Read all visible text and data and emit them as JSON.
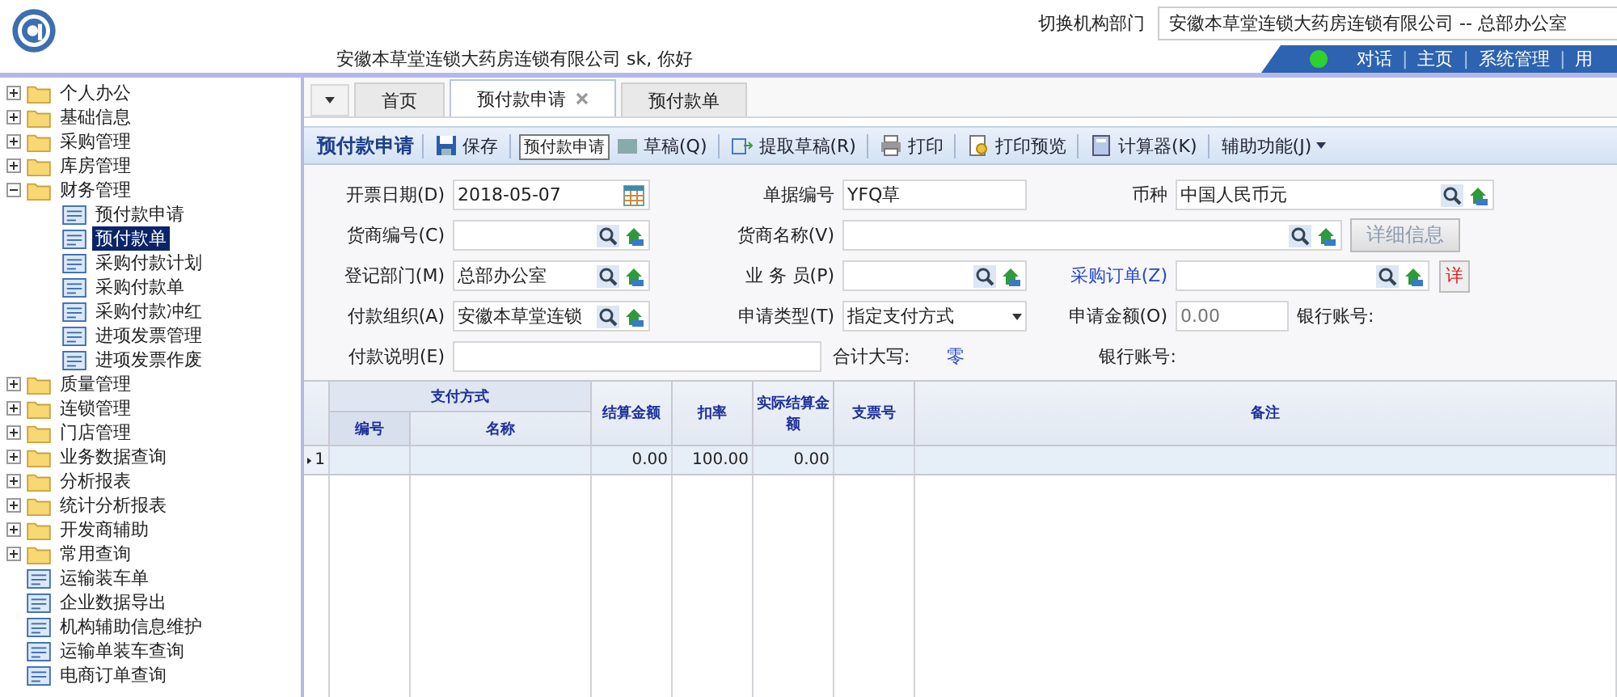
{
  "header": {
    "company_user": "安徽本草堂连锁大药房连锁有限公司  sk, 你好",
    "switch_label": "切换机构部门",
    "switch_value": "安徽本草堂连锁大药房连锁有限公司 -- 总部办公室",
    "nav": [
      {
        "kind": "link",
        "text": "对话"
      },
      {
        "kind": "sep",
        "text": "|"
      },
      {
        "kind": "link",
        "text": "主页"
      },
      {
        "kind": "sep",
        "text": "|"
      },
      {
        "kind": "link",
        "text": "系统管理"
      },
      {
        "kind": "sep",
        "text": "|"
      },
      {
        "kind": "link",
        "text": "用"
      }
    ]
  },
  "sidebar": {
    "items": [
      {
        "kind": "folder",
        "label": "个人办公",
        "expanded": false,
        "selected": false
      },
      {
        "kind": "folder",
        "label": "基础信息",
        "expanded": false,
        "selected": false
      },
      {
        "kind": "folder",
        "label": "采购管理",
        "expanded": false,
        "selected": false
      },
      {
        "kind": "folder",
        "label": "库房管理",
        "expanded": false,
        "selected": false
      },
      {
        "kind": "folder",
        "label": "财务管理",
        "expanded": true,
        "selected": false,
        "children": [
          {
            "kind": "leaf",
            "label": "预付款申请",
            "selected": false
          },
          {
            "kind": "leaf",
            "label": "预付款单",
            "selected": true
          },
          {
            "kind": "leaf",
            "label": "采购付款计划",
            "selected": false
          },
          {
            "kind": "leaf",
            "label": "采购付款单",
            "selected": false
          },
          {
            "kind": "leaf",
            "label": "采购付款冲红",
            "selected": false
          },
          {
            "kind": "leaf",
            "label": "进项发票管理",
            "selected": false
          },
          {
            "kind": "leaf",
            "label": "进项发票作废",
            "selected": false
          }
        ]
      },
      {
        "kind": "folder",
        "label": "质量管理",
        "expanded": false,
        "selected": false
      },
      {
        "kind": "folder",
        "label": "连锁管理",
        "expanded": false,
        "selected": false
      },
      {
        "kind": "folder",
        "label": "门店管理",
        "expanded": false,
        "selected": false
      },
      {
        "kind": "folder",
        "label": "业务数据查询",
        "expanded": false,
        "selected": false
      },
      {
        "kind": "folder",
        "label": "分析报表",
        "expanded": false,
        "selected": false
      },
      {
        "kind": "folder",
        "label": "统计分析报表",
        "expanded": false,
        "selected": false
      },
      {
        "kind": "folder",
        "label": "开发商辅助",
        "expanded": false,
        "selected": false
      },
      {
        "kind": "folder",
        "label": "常用查询",
        "expanded": false,
        "selected": false
      },
      {
        "kind": "leaf",
        "label": "运输装车单",
        "selected": false
      },
      {
        "kind": "leaf",
        "label": "企业数据导出",
        "selected": false
      },
      {
        "kind": "leaf",
        "label": "机构辅助信息维护",
        "selected": false
      },
      {
        "kind": "leaf",
        "label": "运输单装车查询",
        "selected": false
      },
      {
        "kind": "leaf",
        "label": "电商订单查询",
        "selected": false
      }
    ]
  },
  "tabs": [
    {
      "label": "首页",
      "selected": false,
      "closable": false
    },
    {
      "label": "预付款申请",
      "selected": true,
      "closable": true
    },
    {
      "label": "预付款单",
      "selected": false,
      "closable": false
    }
  ],
  "toolbar": {
    "title": "预付款申请",
    "buttons": [
      {
        "kind": "save",
        "label": "保存"
      },
      {
        "kind": "draft",
        "label": "草稿(Q)"
      },
      {
        "kind": "fetch",
        "label": "提取草稿(R)"
      },
      {
        "kind": "print",
        "label": "打印"
      },
      {
        "kind": "preview",
        "label": "打印预览"
      },
      {
        "kind": "calc",
        "label": "计算器(K)"
      },
      {
        "kind": "menu",
        "label": "辅助功能(J)"
      }
    ],
    "tooltip": "预付款申请"
  },
  "form": {
    "invoice_date": {
      "label": "开票日期(D)",
      "value": "2018-05-07"
    },
    "document_no": {
      "label": "单据编号",
      "value": "YFQ草"
    },
    "currency": {
      "label": "币种",
      "value": "中国人民币元"
    },
    "supplier_code": {
      "label": "货商编号(C)"
    },
    "supplier_name": {
      "label": "货商名称(V)"
    },
    "details_button": "详细信息",
    "department": {
      "label": "登记部门(M)",
      "value": "总部办公室"
    },
    "salesperson": {
      "label": "业 务 员(P)"
    },
    "purchase_order": {
      "label": "采购订单(Z)"
    },
    "detail_button": "详",
    "payment_org": {
      "label": "付款组织(A)",
      "value": "安徽本草堂连锁"
    },
    "request_type": {
      "label": "申请类型(T)",
      "value": "指定支付方式"
    },
    "request_amount": {
      "label": "申请金额(O)",
      "placeholder": "0.00"
    },
    "bank_account_1": "银行账号:",
    "remark": {
      "label": "付款说明(E)"
    },
    "total_label": "合计大写:",
    "total_value": "零",
    "bank_account_2": "银行账号:"
  },
  "table": {
    "group": "支付方式",
    "columns": [
      "编号",
      "名称",
      "结算金额",
      "扣率",
      "实际结算金额",
      "支票号",
      "备注"
    ],
    "rows": [
      {
        "index": "1",
        "selected": true,
        "cells": [
          "",
          "",
          "0.00",
          "100.00",
          "0.00",
          "",
          ""
        ]
      }
    ]
  }
}
